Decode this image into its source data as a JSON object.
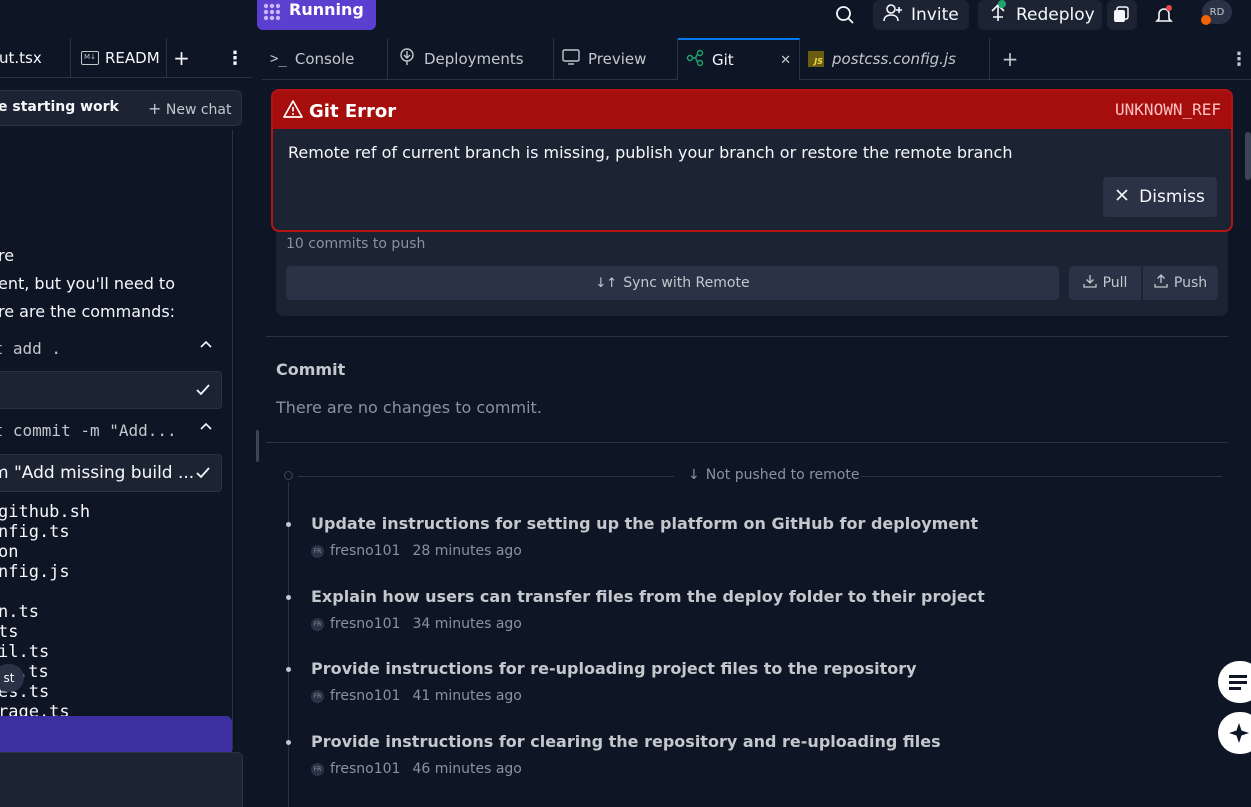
{
  "topbar": {
    "run_status": "Running",
    "invite_label": "Invite",
    "redeploy_label": "Redeploy",
    "avatar_initials": "RD"
  },
  "left": {
    "tabs": [
      {
        "label": "ut.tsx"
      },
      {
        "label": "READM"
      }
    ],
    "chat": {
      "title": "e starting work",
      "new_chat_label": "New chat"
    },
    "lines": [
      "re",
      "ent, but you'll need to",
      "re are the commands:"
    ],
    "commands": [
      {
        "header": "it add .",
        "row": ""
      },
      {
        "header": "it commit -m \"Add...",
        "row": "m \"Add missing build ..."
      }
    ],
    "files": [
      "github.sh",
      "nfig.ts",
      "on",
      "nfig.js",
      "",
      "n.ts",
      "ts",
      "il.ts",
      ".ts",
      "es.ts",
      "rage.ts"
    ],
    "tooltip": "st"
  },
  "tabs": [
    {
      "label": "Console",
      "icon": "terminal-icon"
    },
    {
      "label": "Deployments",
      "icon": "deployments-icon"
    },
    {
      "label": "Preview",
      "icon": "monitor-icon"
    },
    {
      "label": "Git",
      "icon": "git-icon",
      "active": true
    },
    {
      "label": "postcss.config.js",
      "icon": "js-file-icon"
    }
  ],
  "error": {
    "title": "Git Error",
    "code": "UNKNOWN_REF",
    "message": "Remote ref of current branch is missing, publish your branch or restore the remote branch",
    "dismiss_label": "Dismiss",
    "accent": "#a60e0e"
  },
  "remote": {
    "commits_to_push": "10 commits to push",
    "sync_label": "Sync with Remote",
    "pull_label": "Pull",
    "push_label": "Push"
  },
  "commit": {
    "title": "Commit",
    "empty_text": "There are no changes to commit."
  },
  "history": {
    "not_pushed_label": "Not pushed to remote",
    "commits": [
      {
        "message": "Update instructions for setting up the platform on GitHub for deployment",
        "author": "fresno101",
        "time": "28 minutes ago"
      },
      {
        "message": "Explain how users can transfer files from the deploy folder to their project",
        "author": "fresno101",
        "time": "34 minutes ago"
      },
      {
        "message": "Provide instructions for re-uploading project files to the repository",
        "author": "fresno101",
        "time": "41 minutes ago"
      },
      {
        "message": "Provide instructions for clearing the repository and re-uploading files",
        "author": "fresno101",
        "time": "46 minutes ago"
      }
    ],
    "avatar_initials": "FR"
  }
}
